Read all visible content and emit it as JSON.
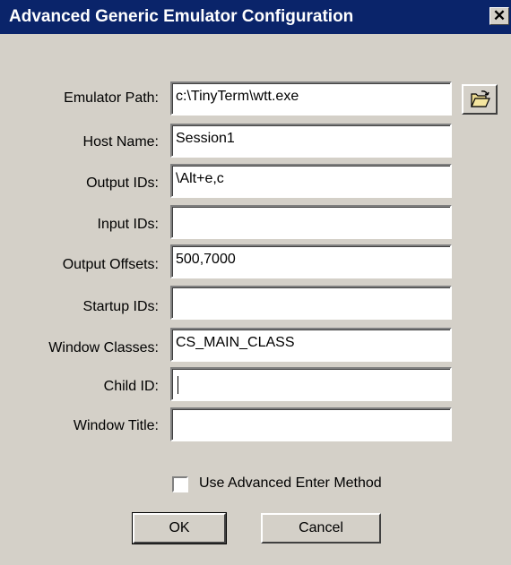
{
  "window": {
    "title": "Advanced Generic Emulator Configuration",
    "close_glyph": "✕"
  },
  "fields": {
    "emulator_path": {
      "label": "Emulator Path:",
      "value": "c:\\TinyTerm\\wtt.exe"
    },
    "host_name": {
      "label": "Host Name:",
      "value": "Session1"
    },
    "output_ids": {
      "label": "Output IDs:",
      "value": "\\Alt+e,c"
    },
    "input_ids": {
      "label": "Input IDs:",
      "value": ""
    },
    "output_offsets": {
      "label": "Output Offsets:",
      "value": "500,7000"
    },
    "startup_ids": {
      "label": "Startup IDs:",
      "value": ""
    },
    "window_classes": {
      "label": "Window Classes:",
      "value": "CS_MAIN_CLASS"
    },
    "child_id": {
      "label": "Child ID:",
      "value": ""
    },
    "window_title": {
      "label": "Window Title:",
      "value": ""
    }
  },
  "options": {
    "advanced_enter": {
      "label": "Use Advanced Enter Method",
      "checked": false
    }
  },
  "buttons": {
    "ok": "OK",
    "cancel": "Cancel",
    "browse_icon": "folder-open-icon"
  },
  "colors": {
    "titlebar": "#0a246a",
    "dialog_bg": "#d4d0c8"
  }
}
